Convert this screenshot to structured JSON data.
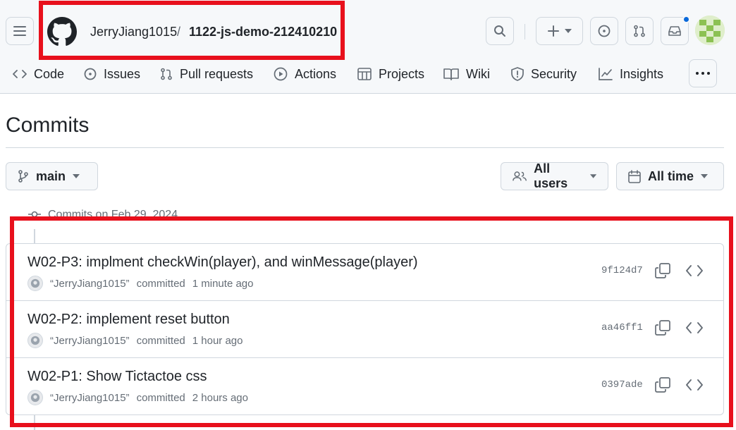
{
  "breadcrumb": {
    "owner": "JerryJiang1015",
    "separator": "/",
    "repo": "1122-js-demo-212410210"
  },
  "header_icons": [
    "menu-icon",
    "github-logo-icon",
    "search-icon",
    "plus-icon",
    "issue-icon",
    "pull-request-icon",
    "inbox-icon"
  ],
  "tabs": [
    {
      "label": "Code",
      "icon": "code-icon"
    },
    {
      "label": "Issues",
      "icon": "issue-icon"
    },
    {
      "label": "Pull requests",
      "icon": "pull-request-icon"
    },
    {
      "label": "Actions",
      "icon": "play-icon"
    },
    {
      "label": "Projects",
      "icon": "table-icon"
    },
    {
      "label": "Wiki",
      "icon": "book-icon"
    },
    {
      "label": "Security",
      "icon": "shield-icon"
    },
    {
      "label": "Insights",
      "icon": "graph-icon"
    }
  ],
  "page_title": "Commits",
  "filters": {
    "branch": "main",
    "users": "All users",
    "time": "All time"
  },
  "group": {
    "label": "Commits on Feb 29, 2024"
  },
  "commits": [
    {
      "message": "W02-P3: implment checkWin(player), and winMessage(player)",
      "author": "“JerryJiang1015”",
      "action": "committed",
      "time": "1 minute ago",
      "sha": "9f124d7"
    },
    {
      "message": "W02-P2: implement reset button",
      "author": "“JerryJiang1015”",
      "action": "committed",
      "time": "1 hour ago",
      "sha": "aa46ff1"
    },
    {
      "message": "W02-P1: Show Tictactoe css",
      "author": "“JerryJiang1015”",
      "action": "committed",
      "time": "2 hours ago",
      "sha": "0397ade"
    }
  ],
  "colors": {
    "highlight": "#e8101c",
    "accent": "#0969da",
    "border": "#d0d7de",
    "muted": "#656d76"
  }
}
